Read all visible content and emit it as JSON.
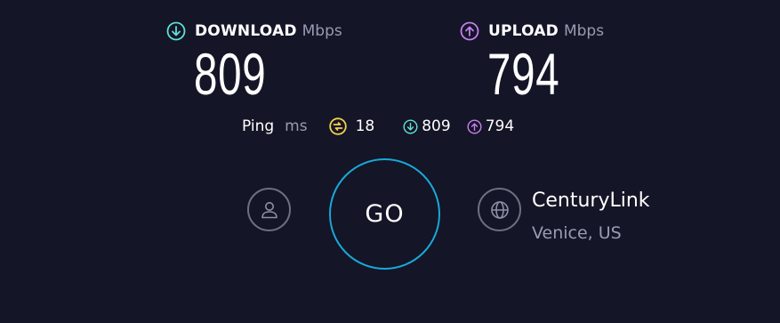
{
  "download": {
    "label": "DOWNLOAD",
    "unit": "Mbps",
    "value": "809",
    "icon": "arrow-down-circle-icon",
    "color": "#5fe0d3"
  },
  "upload": {
    "label": "UPLOAD",
    "unit": "Mbps",
    "value": "794",
    "icon": "arrow-up-circle-icon",
    "color": "#c47ff0"
  },
  "ping": {
    "label": "Ping",
    "unit": "ms",
    "value": "18",
    "icon": "ping-icon",
    "color": "#f3d04f",
    "download_value": "809",
    "upload_value": "794"
  },
  "go_button": {
    "label": "GO",
    "color": "#19a8d8"
  },
  "account": {
    "icon": "user-icon"
  },
  "server": {
    "icon": "globe-icon",
    "provider": "CenturyLink",
    "location": "Venice, US"
  }
}
